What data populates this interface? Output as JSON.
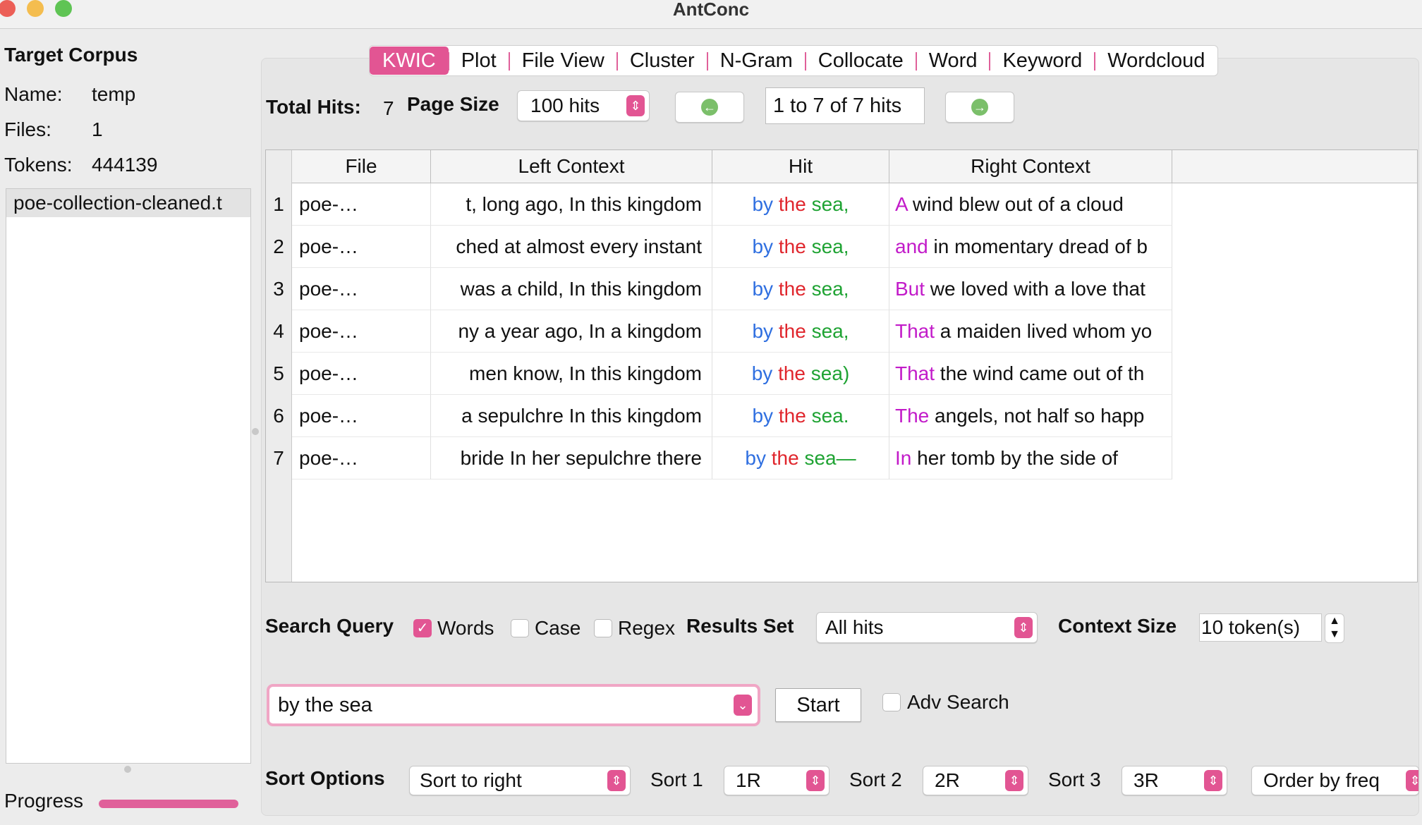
{
  "window": {
    "title": "AntConc"
  },
  "corpus": {
    "heading": "Target Corpus",
    "name_label": "Name:",
    "name_value": "temp",
    "files_label": "Files:",
    "files_value": "1",
    "tokens_label": "Tokens:",
    "tokens_value": "444139",
    "items": [
      "poe-collection-cleaned.t"
    ]
  },
  "progress": {
    "label": "Progress",
    "fraction": 1.0
  },
  "tabs": [
    "KWIC",
    "Plot",
    "File View",
    "Cluster",
    "N-Gram",
    "Collocate",
    "Word",
    "Keyword",
    "Wordcloud"
  ],
  "active_tab": "KWIC",
  "toolbar": {
    "total_hits_label": "Total Hits:",
    "total_hits_value": "7",
    "page_size_label": "Page Size",
    "page_size_value": "100 hits",
    "range_text": "1 to 7 of 7 hits"
  },
  "table": {
    "columns": [
      "File",
      "Left Context",
      "Hit",
      "Right Context"
    ],
    "rows": [
      {
        "n": "1",
        "file": "poe-…",
        "left": "t, long ago, In this kingdom",
        "hit": [
          "by",
          "the",
          "sea,"
        ],
        "rfirst": "A",
        "rrest": " wind blew out of a cloud"
      },
      {
        "n": "2",
        "file": "poe-…",
        "left": "ched at almost every instant",
        "hit": [
          "by",
          "the",
          "sea,"
        ],
        "rfirst": "and",
        "rrest": " in momentary dread of b"
      },
      {
        "n": "3",
        "file": "poe-…",
        "left": "was a child, In this kingdom",
        "hit": [
          "by",
          "the",
          "sea,"
        ],
        "rfirst": "But",
        "rrest": " we loved with a love that"
      },
      {
        "n": "4",
        "file": "poe-…",
        "left": "ny a year ago, In a kingdom",
        "hit": [
          "by",
          "the",
          "sea,"
        ],
        "rfirst": "That",
        "rrest": " a maiden lived whom yo"
      },
      {
        "n": "5",
        "file": "poe-…",
        "left": "men know, In this kingdom",
        "hit": [
          "by",
          "the",
          "sea)"
        ],
        "rfirst": "That",
        "rrest": " the wind came out of th"
      },
      {
        "n": "6",
        "file": "poe-…",
        "left": "a sepulchre In this kingdom",
        "hit": [
          "by",
          "the",
          "sea."
        ],
        "rfirst": "The",
        "rrest": " angels, not half so happ"
      },
      {
        "n": "7",
        "file": "poe-…",
        "left": "bride In her sepulchre there",
        "hit": [
          "by",
          "the",
          "sea—"
        ],
        "rfirst": "In",
        "rrest": " her tomb by the side of"
      }
    ]
  },
  "search": {
    "label": "Search Query",
    "words_label": "Words",
    "words_checked": true,
    "case_label": "Case",
    "case_checked": false,
    "regex_label": "Regex",
    "regex_checked": false,
    "results_set_label": "Results Set",
    "results_set_value": "All hits",
    "context_size_label": "Context Size",
    "context_size_value": "10 token(s)",
    "query": "by the sea",
    "start_label": "Start",
    "adv_label": "Adv Search",
    "adv_checked": false
  },
  "sort": {
    "label": "Sort Options",
    "mode": "Sort to right",
    "sort1_label": "Sort 1",
    "sort1_value": "1R",
    "sort2_label": "Sort 2",
    "sort2_value": "2R",
    "sort3_label": "Sort 3",
    "sort3_value": "3R",
    "order": "Order by freq"
  },
  "colors": {
    "accent": "#e25593",
    "hit_by": "#2f6fe0",
    "hit_the": "#e0262d",
    "hit_sea": "#1fa333",
    "right_first": "#c21bc9"
  }
}
